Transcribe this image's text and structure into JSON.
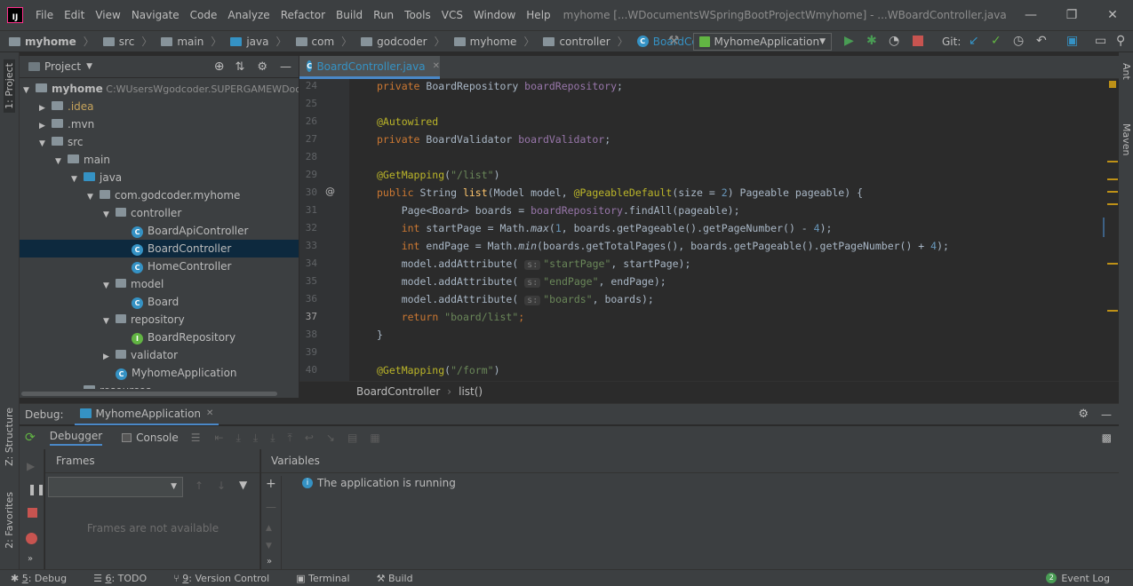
{
  "window": {
    "title": "myhome [...WDocumentsWSpringBootProjectWmyhome] - ...WBoardController.java",
    "menu": [
      "File",
      "Edit",
      "View",
      "Navigate",
      "Code",
      "Analyze",
      "Refactor",
      "Build",
      "Run",
      "Tools",
      "VCS",
      "Window",
      "Help"
    ]
  },
  "breadcrumb": [
    "myhome",
    "src",
    "main",
    "java",
    "com",
    "godcoder",
    "myhome",
    "controller",
    "BoardController"
  ],
  "toolbar": {
    "run_config": "MyhomeApplication",
    "git_label": "Git:"
  },
  "left_strip": {
    "project_tab": "1: Project",
    "structure_tab": "Z: Structure",
    "favorites_tab": "2: Favorites"
  },
  "right_strip": {
    "ant_tab": "Ant",
    "maven_tab": "Maven"
  },
  "project": {
    "header": "Project",
    "tree": [
      {
        "label": "myhome",
        "extra": "C:WUsersWgodcoder.SUPERGAMEWDocumentsWSpringBootProjectWmyhome",
        "indent": 0,
        "icon": "folder",
        "arrow": "open",
        "bold": true
      },
      {
        "label": ".idea",
        "indent": 1,
        "icon": "folder",
        "arrow": "closed",
        "color": "#c5a35c"
      },
      {
        "label": ".mvn",
        "indent": 1,
        "icon": "folder",
        "arrow": "closed"
      },
      {
        "label": "src",
        "indent": 1,
        "icon": "folder",
        "arrow": "open"
      },
      {
        "label": "main",
        "indent": 2,
        "icon": "folder",
        "arrow": "open"
      },
      {
        "label": "java",
        "indent": 3,
        "icon": "folder-blue",
        "arrow": "open"
      },
      {
        "label": "com.godcoder.myhome",
        "indent": 4,
        "icon": "package",
        "arrow": "open"
      },
      {
        "label": "controller",
        "indent": 5,
        "icon": "package",
        "arrow": "open"
      },
      {
        "label": "BoardApiController",
        "indent": 6,
        "icon": "class"
      },
      {
        "label": "BoardController",
        "indent": 6,
        "icon": "class",
        "selected": true
      },
      {
        "label": "HomeController",
        "indent": 6,
        "icon": "class"
      },
      {
        "label": "model",
        "indent": 5,
        "icon": "package",
        "arrow": "open"
      },
      {
        "label": "Board",
        "indent": 6,
        "icon": "class"
      },
      {
        "label": "repository",
        "indent": 5,
        "icon": "package",
        "arrow": "open"
      },
      {
        "label": "BoardRepository",
        "indent": 6,
        "icon": "interface"
      },
      {
        "label": "validator",
        "indent": 5,
        "icon": "package",
        "arrow": "closed"
      },
      {
        "label": "MyhomeApplication",
        "indent": 5,
        "icon": "class"
      },
      {
        "label": "resources",
        "indent": 3,
        "icon": "folder",
        "arrow": "open"
      }
    ]
  },
  "editor": {
    "tab": "BoardController.java",
    "line_numbers": [
      "24",
      "25",
      "26",
      "27",
      "28",
      "29",
      "30",
      "31",
      "32",
      "33",
      "34",
      "35",
      "36",
      "37",
      "38",
      "39",
      "40"
    ],
    "lines": [
      [
        [
          "kw",
          "private "
        ],
        [
          "",
          "BoardRepository "
        ],
        [
          "fld",
          "boardRepository"
        ],
        [
          "",
          ";"
        ]
      ],
      [],
      [
        [
          "ann",
          "@Autowired"
        ]
      ],
      [
        [
          "kw",
          "private "
        ],
        [
          "",
          "BoardValidator "
        ],
        [
          "fld",
          "boardValidator"
        ],
        [
          "",
          ";"
        ]
      ],
      [],
      [
        [
          "ann",
          "@GetMapping"
        ],
        [
          "",
          "("
        ],
        [
          "str",
          "\"/list\""
        ],
        [
          "",
          ")"
        ]
      ],
      [
        [
          "kw",
          "public "
        ],
        [
          "",
          "String "
        ],
        [
          "fn",
          "list"
        ],
        [
          "",
          "(Model model, "
        ],
        [
          "ann",
          "@PageableDefault"
        ],
        [
          "",
          "(size = "
        ],
        [
          "num",
          "2"
        ],
        [
          "",
          ") Pageable pageable) {"
        ]
      ],
      [
        [
          "",
          "    Page<Board> boards = "
        ],
        [
          "fld",
          "boardRepository"
        ],
        [
          "",
          ".findAll(pageable);"
        ]
      ],
      [
        [
          "",
          "    "
        ],
        [
          "kw",
          "int "
        ],
        [
          "",
          "startPage = Math."
        ],
        [
          "ital",
          "max"
        ],
        [
          "",
          "("
        ],
        [
          "num",
          "1"
        ],
        [
          "",
          ", boards.getPageable().getPageNumber() - "
        ],
        [
          "num",
          "4"
        ],
        [
          "",
          ");"
        ]
      ],
      [
        [
          "",
          "    "
        ],
        [
          "kw",
          "int "
        ],
        [
          "",
          "endPage = Math."
        ],
        [
          "ital",
          "min"
        ],
        [
          "",
          "(boards.getTotalPages(), boards.getPageable().getPageNumber() + "
        ],
        [
          "num",
          "4"
        ],
        [
          "",
          ");"
        ]
      ],
      [
        [
          "",
          "    model.addAttribute( "
        ],
        [
          "hint",
          "s:"
        ],
        [
          "str",
          "\"startPage\""
        ],
        [
          "",
          ", startPage);"
        ]
      ],
      [
        [
          "",
          "    model.addAttribute( "
        ],
        [
          "hint",
          "s:"
        ],
        [
          "str",
          "\"endPage\""
        ],
        [
          "",
          ", endPage);"
        ]
      ],
      [
        [
          "",
          "    model.addAttribute( "
        ],
        [
          "hint",
          "s:"
        ],
        [
          "str",
          "\"boards\""
        ],
        [
          "",
          ", boards);"
        ]
      ],
      [
        [
          "",
          "    "
        ],
        [
          "kw",
          "return "
        ],
        [
          "str",
          "\"board/list\""
        ],
        [
          "kw",
          ";"
        ]
      ],
      [
        [
          "",
          "}"
        ]
      ],
      [],
      [
        [
          "ann",
          "@GetMapping"
        ],
        [
          "",
          "("
        ],
        [
          "str",
          "\"/form\""
        ],
        [
          "",
          ")"
        ]
      ]
    ],
    "breadcrumb": [
      "BoardController",
      "list()"
    ]
  },
  "debug": {
    "label": "Debug:",
    "config": "MyhomeApplication",
    "tabs": {
      "debugger": "Debugger",
      "console": "Console"
    },
    "frames_header": "Frames",
    "variables_header": "Variables",
    "frames_empty": "Frames are not available",
    "status_message": "The application is running"
  },
  "statusbar": {
    "items": [
      {
        "prefix": "5",
        "label": ": Debug"
      },
      {
        "prefix": "6",
        "label": ": TODO"
      },
      {
        "prefix": "9",
        "label": ": Version Control"
      },
      {
        "prefix": "",
        "label": "Terminal"
      },
      {
        "prefix": "",
        "label": "Build"
      }
    ],
    "event_log": "Event Log",
    "event_count": "2"
  }
}
